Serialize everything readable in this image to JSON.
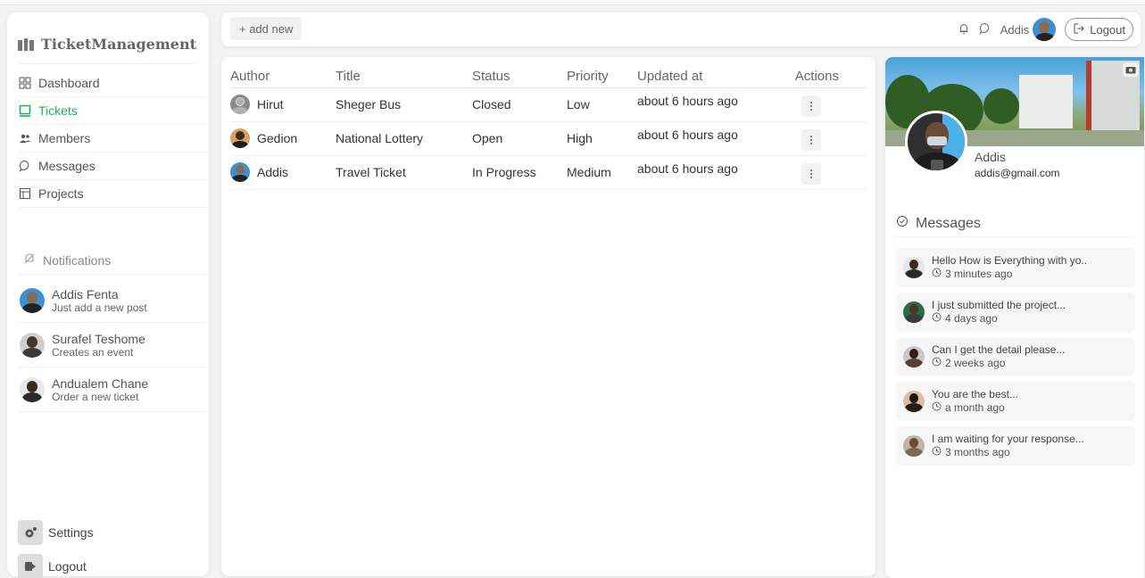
{
  "app": {
    "brand": "TicketManagement"
  },
  "sidebar": {
    "items": [
      {
        "label": "Dashboard",
        "icon": "dashboard-icon",
        "active": false
      },
      {
        "label": "Tickets",
        "icon": "ticket-icon",
        "active": true
      },
      {
        "label": "Members",
        "icon": "members-icon",
        "active": false
      },
      {
        "label": "Messages",
        "icon": "messages-icon",
        "active": false
      },
      {
        "label": "Projects",
        "icon": "projects-icon",
        "active": false
      }
    ],
    "notifications_title": "Notifications",
    "notifications": [
      {
        "name": "Addis Fenta",
        "text": "Just add a new post"
      },
      {
        "name": "Surafel Teshome",
        "text": "Creates an event"
      },
      {
        "name": "Andualem Chane",
        "text": "Order a new ticket"
      }
    ],
    "settings_label": "Settings",
    "logout_label": "Logout"
  },
  "topbar": {
    "add_label": "+ add new",
    "user_name": "Addis",
    "logout_label": "Logout"
  },
  "table": {
    "headers": [
      "Author",
      "Title",
      "Status",
      "Priority",
      "Updated at",
      "Actions"
    ],
    "rows": [
      {
        "author": "Hirut",
        "title": "Sheger Bus",
        "status": "Closed",
        "priority": "Low",
        "updated": "about 6 hours ago"
      },
      {
        "author": "Gedion",
        "title": "National Lottery",
        "status": "Open",
        "priority": "High",
        "updated": "about 6 hours ago"
      },
      {
        "author": "Addis",
        "title": "Travel Ticket",
        "status": "In Progress",
        "priority": "Medium",
        "updated": "about 6 hours ago"
      }
    ]
  },
  "profile": {
    "name": "Addis",
    "email": "addis@gmail.com",
    "messages_title": "Messages",
    "messages": [
      {
        "text": "Hello How is Everything with yo..",
        "time": "3 minutes ago"
      },
      {
        "text": "I just submitted the project...",
        "time": "4 days ago"
      },
      {
        "text": "Can I get the detail please...",
        "time": "2 weeks ago"
      },
      {
        "text": "You are the best...",
        "time": "a month ago"
      },
      {
        "text": "I am waiting for your response...",
        "time": "3 months ago"
      }
    ]
  },
  "colors": {
    "accent": "#19b35a",
    "panel": "#ffffff",
    "background": "#f3f3f4"
  }
}
